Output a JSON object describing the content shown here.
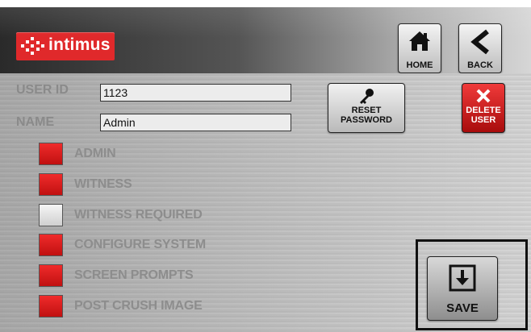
{
  "header": {
    "logo_text": "intimus",
    "home_label": "HOME",
    "back_label": "BACK"
  },
  "form": {
    "user_id_label": "USER ID",
    "user_id_value": "1123",
    "name_label": "NAME",
    "name_value": "Admin"
  },
  "actions": {
    "reset_line1": "RESET",
    "reset_line2": "PASSWORD",
    "delete_line1": "DELETE",
    "delete_line2": "USER",
    "save_label": "SAVE"
  },
  "permissions": [
    {
      "label": "ADMIN",
      "checked": true
    },
    {
      "label": "WITNESS",
      "checked": true
    },
    {
      "label": "WITNESS REQUIRED",
      "checked": false
    },
    {
      "label": "CONFIGURE SYSTEM",
      "checked": true
    },
    {
      "label": "SCREEN PROMPTS",
      "checked": true
    },
    {
      "label": "POST CRUSH IMAGE",
      "checked": true
    }
  ],
  "colors": {
    "checked": "#e0292b",
    "unchecked": "#e6e6e6",
    "brand": "#e0292b"
  }
}
